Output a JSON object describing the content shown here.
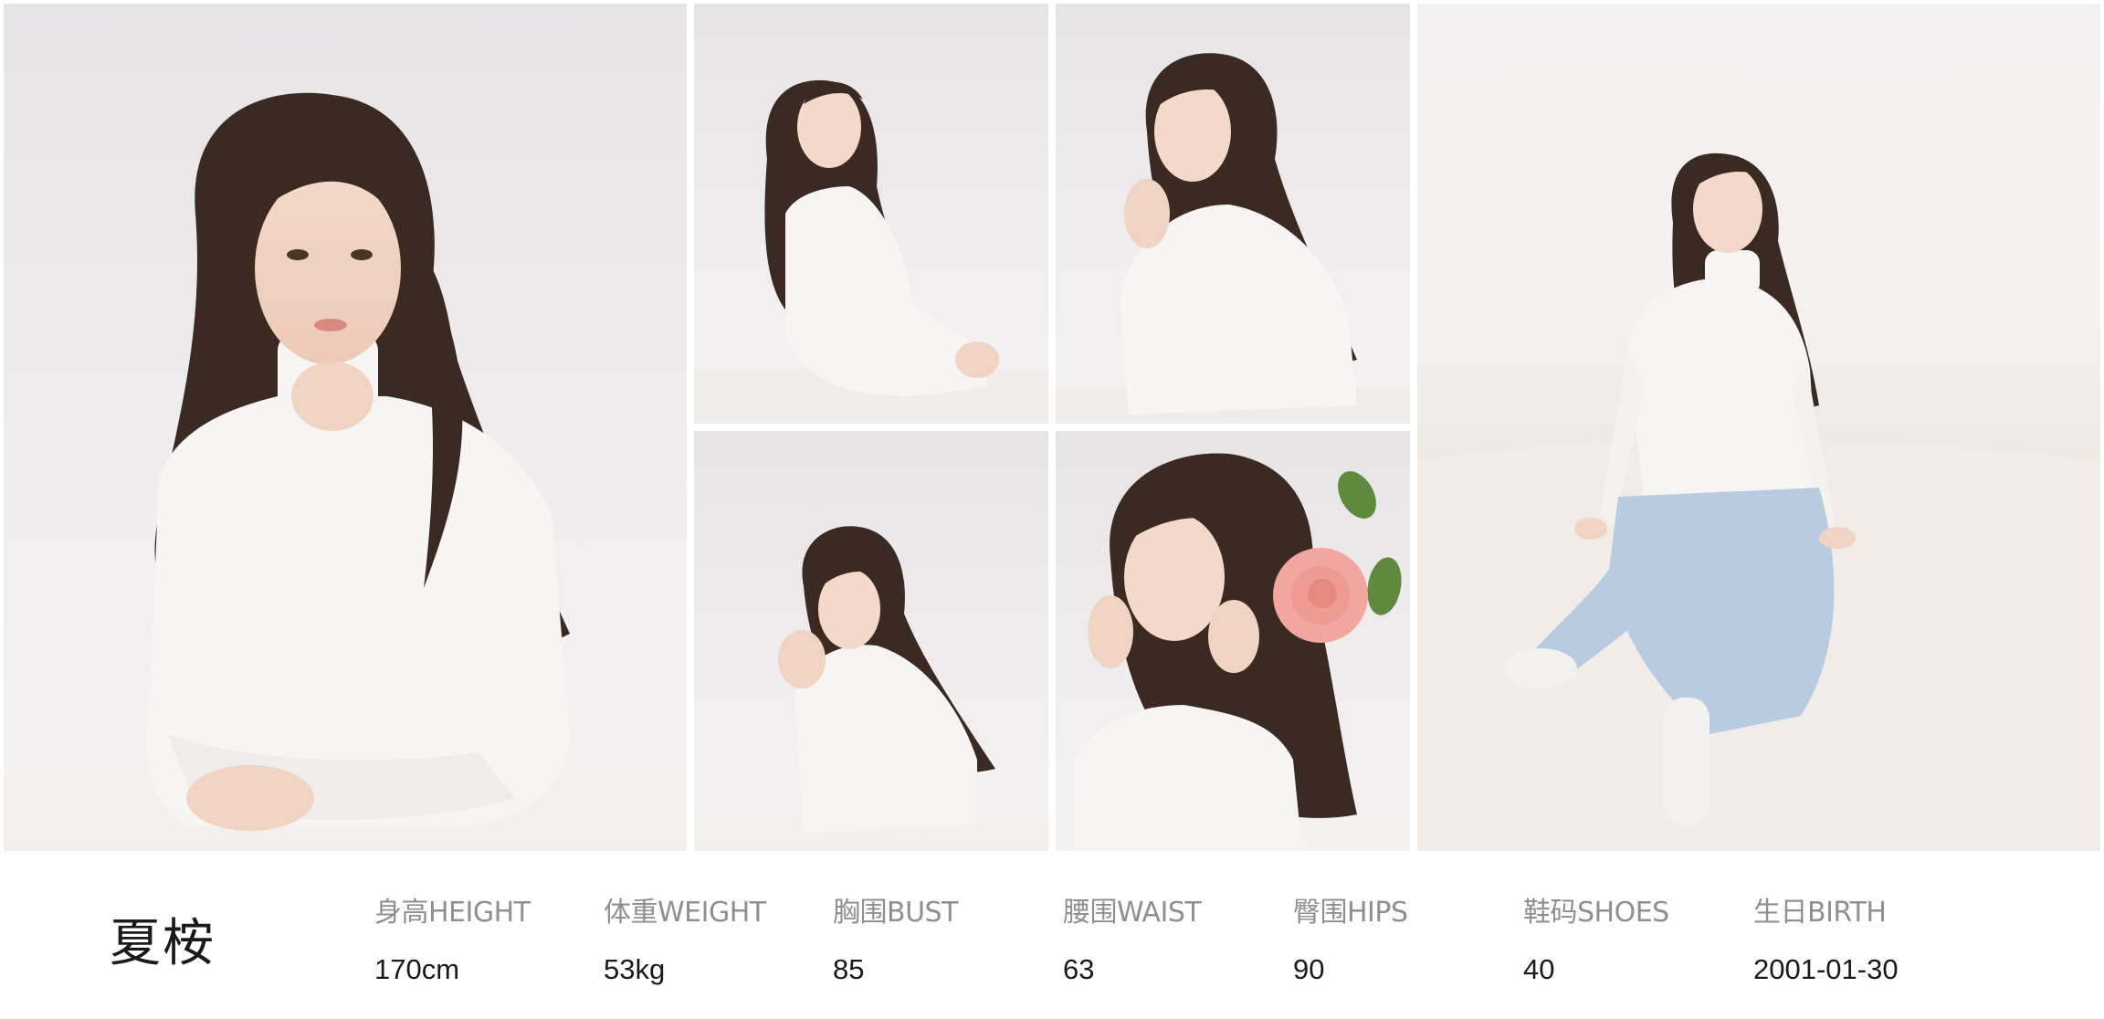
{
  "profile": {
    "name": "夏桉",
    "stats": [
      {
        "label": "身高HEIGHT",
        "value": "170cm"
      },
      {
        "label": "体重WEIGHT",
        "value": "53kg"
      },
      {
        "label": "胸围BUST",
        "value": "85"
      },
      {
        "label": "腰围WAIST",
        "value": "63"
      },
      {
        "label": "臀围HIPS",
        "value": "90"
      },
      {
        "label": "鞋码SHOES",
        "value": "40"
      },
      {
        "label": "生日BIRTH",
        "value": "2001-01-30"
      }
    ]
  },
  "colors": {
    "background": "#ffffff",
    "name_text": "#1a1a1a",
    "label_text": "#8f8f8f",
    "value_text": "#1a1a1a",
    "sweater": "#f7f5f3",
    "hair": "#3a2a22",
    "jeans": "#b9cbe0",
    "rose": "#f3a6a0"
  }
}
